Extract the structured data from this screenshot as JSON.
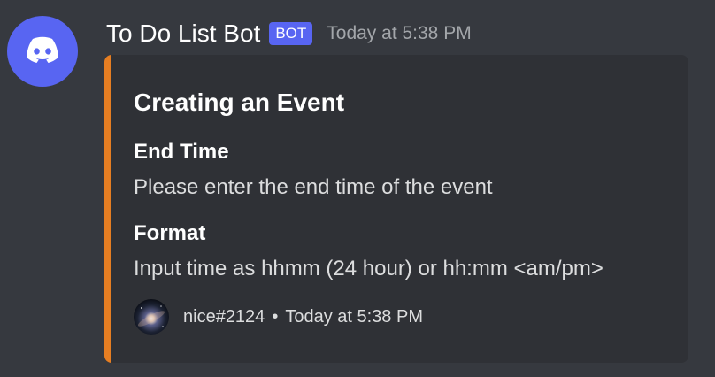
{
  "message": {
    "author": {
      "name": "To Do List Bot",
      "tag": "BOT",
      "avatar_icon": "discord-logo-icon"
    },
    "timestamp": "Today at 5:38 PM",
    "embed": {
      "accent_color": "#e67e22",
      "title": "Creating an Event",
      "fields": [
        {
          "name": "End Time",
          "value": "Please enter the end time of the event"
        },
        {
          "name": "Format",
          "value": "Input time as hhmm (24 hour) or hh:mm <am/pm>"
        }
      ],
      "footer": {
        "text": "nice#2124",
        "separator": "•",
        "timestamp": "Today at 5:38 PM",
        "icon": "galaxy-avatar-icon"
      }
    }
  },
  "colors": {
    "background": "#36393f",
    "embed_background": "#2f3136",
    "blurple": "#5865f2"
  }
}
